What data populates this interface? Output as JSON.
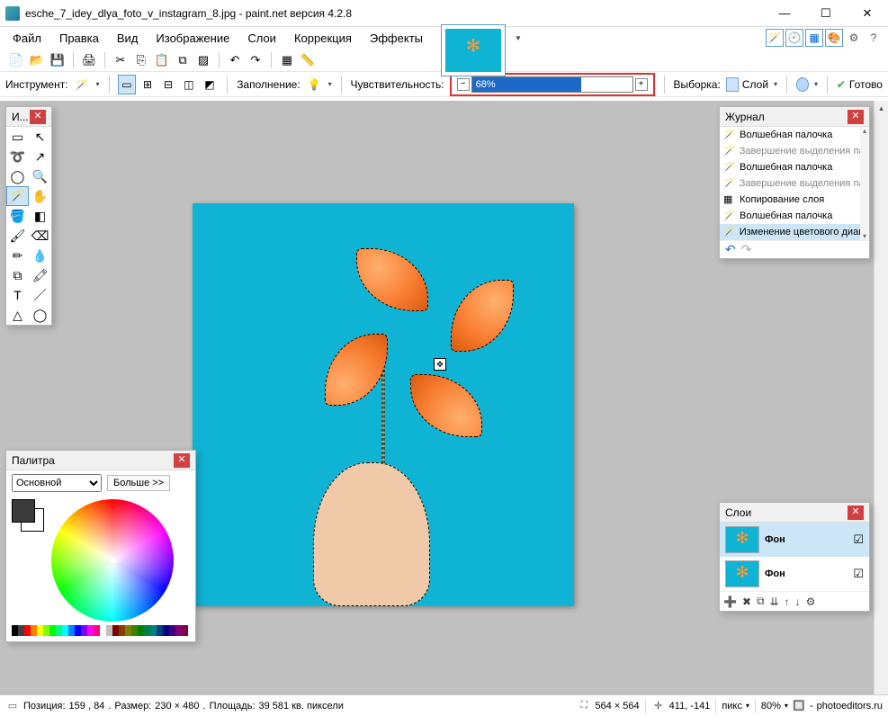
{
  "titlebar": {
    "filename": "esche_7_idey_dlya_foto_v_instagram_8.jpg",
    "app": "paint.net версия 4.2.8"
  },
  "menu": {
    "file": "Файл",
    "edit": "Правка",
    "view": "Вид",
    "image": "Изображение",
    "layers": "Слои",
    "adjust": "Коррекция",
    "effects": "Эффекты"
  },
  "tooloptions": {
    "tool_label": "Инструмент:",
    "fill_label": "Заполнение:",
    "tolerance_label": "Чувствительность:",
    "tolerance_value": "68%",
    "sample_label": "Выборка:",
    "layer_label": "Слой",
    "commit_label": "Готово"
  },
  "tools_panel": {
    "title": "И..."
  },
  "history": {
    "title": "Журнал",
    "items": [
      "Волшебная палочка",
      "Завершение выделения палочкой",
      "Волшебная палочка",
      "Завершение выделения палочкой",
      "Копирование слоя",
      "Волшебная палочка",
      "Изменение цветового диапазона"
    ]
  },
  "layers": {
    "title": "Слои",
    "items": [
      "Фон",
      "Фон"
    ]
  },
  "palette": {
    "title": "Палитра",
    "mode": "Основной",
    "more": "Больше >>"
  },
  "statusbar": {
    "pos_label": "Позиция:",
    "pos_value": "159 , 84",
    "size_label": "Размер:",
    "size_value": "230   × 480",
    "area_label": "Площадь:",
    "area_value": "39 581 кв. пиксели",
    "canvas_size": "564 × 564",
    "cursor": "411, -141",
    "units": "пикс",
    "zoom": "80%",
    "site": "photoeditors.ru"
  },
  "colors": {
    "accent": "#1e69c7",
    "canvas_bg": "#0fb3d3",
    "highlight_border": "#e03030"
  },
  "palette_strip": [
    "#000",
    "#404040",
    "#ff0000",
    "#ff8000",
    "#ffff00",
    "#80ff00",
    "#00ff00",
    "#00ff80",
    "#00ffff",
    "#0080ff",
    "#0000ff",
    "#8000ff",
    "#ff00ff",
    "#ff0080",
    "#fff",
    "#c0c0c0",
    "#800000",
    "#804000",
    "#808000",
    "#408000",
    "#008000",
    "#008040",
    "#008080",
    "#004080",
    "#000080",
    "#400080",
    "#800080",
    "#800040"
  ]
}
